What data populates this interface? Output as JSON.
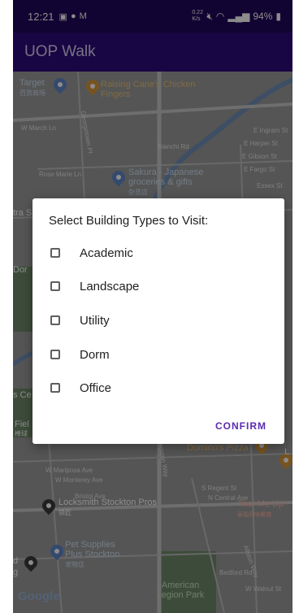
{
  "status_bar": {
    "time": "12:21",
    "data_speed": "0.22 K/s",
    "battery": "94%"
  },
  "app_bar": {
    "title": "UOP Walk"
  },
  "map": {
    "pois": [
      {
        "name": "Target",
        "sub": "百货商场",
        "color": "blue"
      },
      {
        "name": "Raising Cane's Chicken Fingers",
        "color": "orange"
      },
      {
        "name": "Sakura - Japanese groceries & gifts",
        "sub": "杂货店",
        "color": "blue"
      },
      {
        "name": "Domino's Pizza",
        "color": "orange"
      },
      {
        "name": "Locksmith Stockton Pros",
        "sub": "锁匠",
        "color": "dark"
      },
      {
        "name": "Thai Me Up",
        "sub": "泰国风味餐馆",
        "color": "red"
      },
      {
        "name": "Pet Supplies Plus Stockton",
        "sub": "宠物店",
        "color": "blue"
      },
      {
        "name": "American Legion Park",
        "color": "green"
      }
    ],
    "streets": [
      "W March Ln",
      "Georgetown Pl",
      "Bianchi Rd",
      "Rose Marie Ln",
      "E Ingram St",
      "E Harper St",
      "E Gibson St",
      "E Fargo St",
      "Essex St",
      "W Mariposa Ave",
      "W Monterey Ave",
      "Bristol Ave",
      "S Regent St",
      "N Central Ave",
      "Bedford Rd",
      "W Walnut St",
      "Allston Way",
      "Kingston Way"
    ],
    "partial_labels": [
      "tra S",
      "Dor",
      "s Ce",
      "Fiel",
      "棒球",
      "d",
      "g",
      "L"
    ],
    "logo": "Google"
  },
  "dialog": {
    "title": "Select Building Types to Visit:",
    "options": [
      {
        "label": "Academic",
        "checked": false
      },
      {
        "label": "Landscape",
        "checked": false
      },
      {
        "label": "Utility",
        "checked": false
      },
      {
        "label": "Dorm",
        "checked": false
      },
      {
        "label": "Office",
        "checked": false
      }
    ],
    "confirm_label": "CONFIRM"
  }
}
